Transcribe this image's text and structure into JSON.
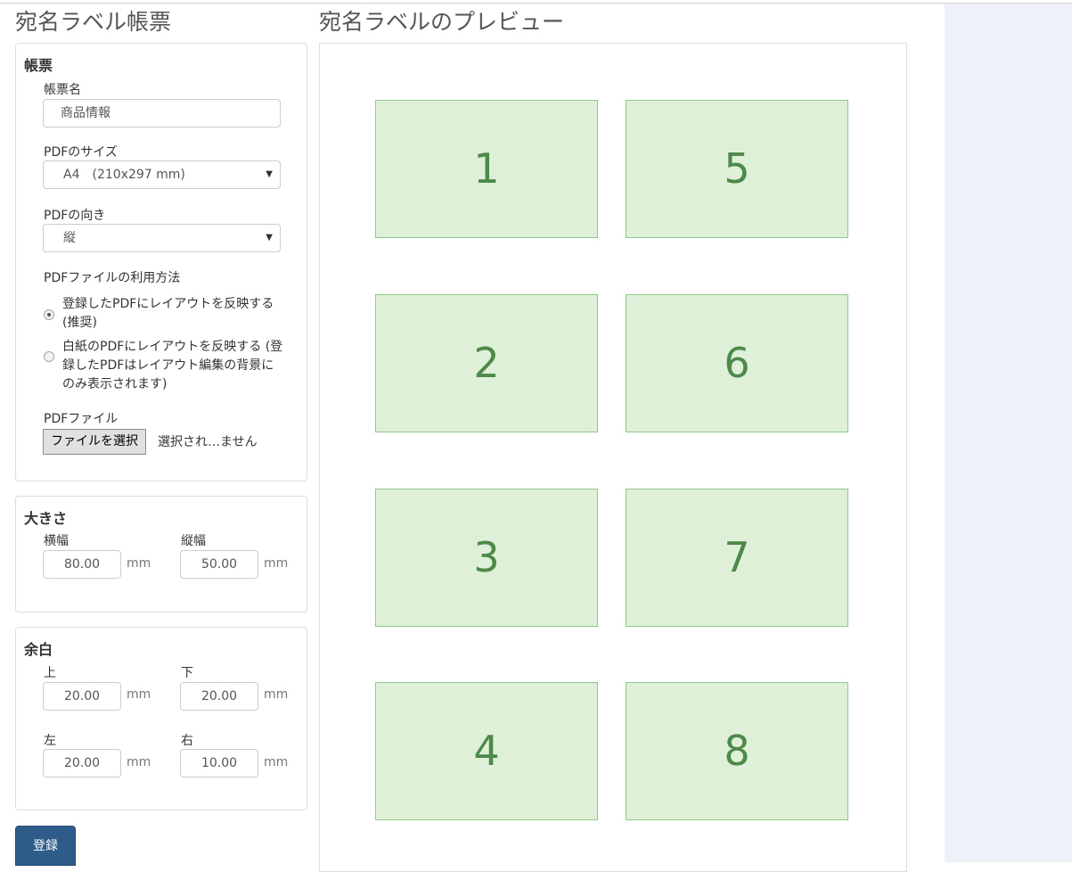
{
  "form_title": "宛名ラベル帳票",
  "preview_title": "宛名ラベルのプレビュー",
  "form_panel": {
    "heading": "帳票",
    "name_label": "帳票名",
    "name_value": "商品情報",
    "pdf_size_label": "PDFのサイズ",
    "pdf_size_value": "A4　(210x297 mm)",
    "pdf_orientation_label": "PDFの向き",
    "pdf_orientation_value": "縦",
    "usage_label": "PDFファイルの利用方法",
    "usage_options": [
      {
        "label": "登録したPDFにレイアウトを反映する (推奨)",
        "checked": true
      },
      {
        "label": "白紙のPDFにレイアウトを反映する (登録したPDFはレイアウト編集の背景にのみ表示されます)",
        "checked": false
      }
    ],
    "pdf_file_label": "PDFファイル",
    "file_button_label": "ファイルを選択",
    "file_status": "選択され…ません"
  },
  "size_panel": {
    "heading": "大きさ",
    "width_label": "横幅",
    "width_value": "80.00",
    "height_label": "縦幅",
    "height_value": "50.00",
    "unit": "mm"
  },
  "margin_panel": {
    "heading": "余白",
    "top_label": "上",
    "top_value": "20.00",
    "bottom_label": "下",
    "bottom_value": "20.00",
    "left_label": "左",
    "left_value": "20.00",
    "right_label": "右",
    "right_value": "10.00",
    "unit": "mm"
  },
  "submit_label": "登録",
  "preview_labels": [
    "1",
    "5",
    "2",
    "6",
    "3",
    "7",
    "4",
    "8"
  ],
  "colors": {
    "label_fill": "#dff0d8",
    "label_border": "#8fc98a",
    "label_text": "#4d8a49",
    "primary_button": "#2e5c8a"
  }
}
